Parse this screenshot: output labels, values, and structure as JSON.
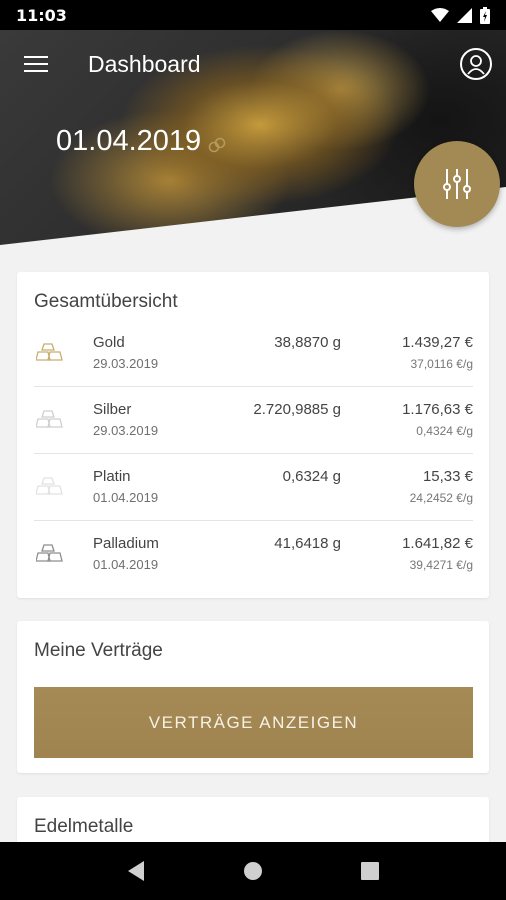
{
  "status": {
    "time": "11:03"
  },
  "header": {
    "title": "Dashboard",
    "date": "01.04.2019"
  },
  "overview": {
    "title": "Gesamtübersicht",
    "rows": [
      {
        "name": "Gold",
        "date": "29.03.2019",
        "weight": "38,8870 g",
        "value": "1.439,27 €",
        "rate": "37,0116 €/g",
        "icon_color": "#c9ad6f"
      },
      {
        "name": "Silber",
        "date": "29.03.2019",
        "weight": "2.720,9885 g",
        "value": "1.176,63 €",
        "rate": "0,4324 €/g",
        "icon_color": "#cfcfcf"
      },
      {
        "name": "Platin",
        "date": "01.04.2019",
        "weight": "0,6324 g",
        "value": "15,33 €",
        "rate": "24,2452 €/g",
        "icon_color": "#e2e2e2"
      },
      {
        "name": "Palladium",
        "date": "01.04.2019",
        "weight": "41,6418 g",
        "value": "1.641,82 €",
        "rate": "39,4271 €/g",
        "icon_color": "#8e8e8e"
      }
    ]
  },
  "contracts": {
    "title": "Meine Verträge",
    "button_label": "VERTRÄGE ANZEIGEN"
  },
  "metals": {
    "title": "Edelmetalle"
  },
  "colors": {
    "accent": "#a38a55",
    "background": "#f2f2f2",
    "card": "#ffffff"
  },
  "icons": [
    "menu-icon",
    "profile-icon",
    "link-icon",
    "sliders-icon",
    "gold-bars-icon",
    "back-icon",
    "home-icon",
    "recents-icon",
    "wifi-icon",
    "signal-icon",
    "battery-icon"
  ]
}
